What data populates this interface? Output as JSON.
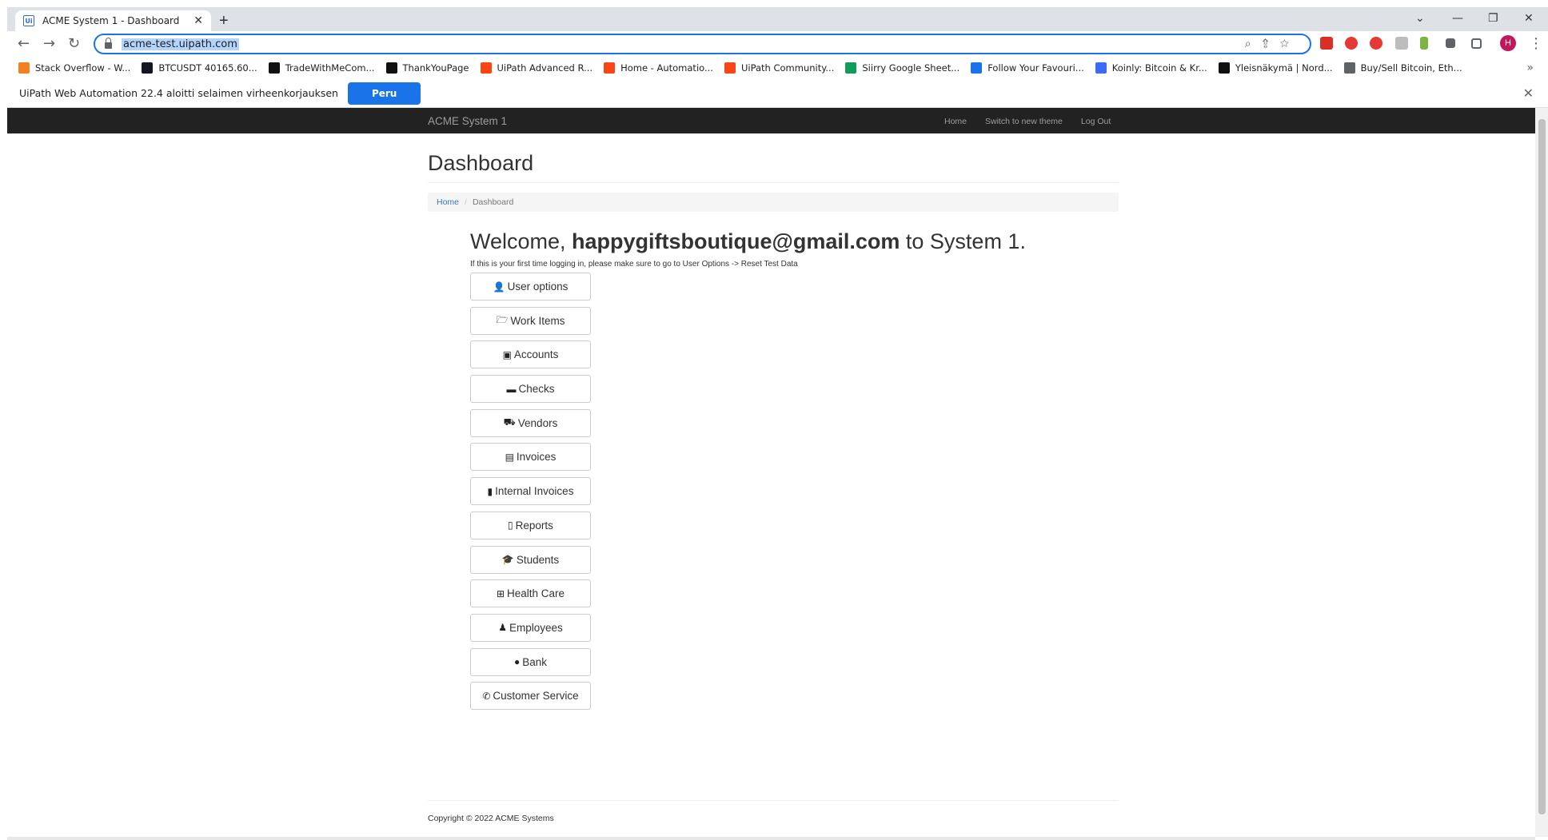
{
  "browser": {
    "tab_title": "ACME System 1 - Dashboard",
    "tab_favicon": "Ui",
    "new_tab": "+",
    "url": "acme-test.uipath.com",
    "profile_initial": "H",
    "bookmarks": [
      {
        "label": "Stack Overflow - W...",
        "color": "#f48024"
      },
      {
        "label": "BTCUSDT 40165.60...",
        "color": "#131722"
      },
      {
        "label": "TradeWithMeCom...",
        "color": "#111111"
      },
      {
        "label": "ThankYouPage",
        "color": "#111111"
      },
      {
        "label": "UiPath Advanced R...",
        "color": "#fa4616"
      },
      {
        "label": "Home - Automatio...",
        "color": "#fa4616"
      },
      {
        "label": "UiPath Community...",
        "color": "#fa4616"
      },
      {
        "label": "Siirry Google Sheet...",
        "color": "#0f9d58"
      },
      {
        "label": "Follow Your Favouri...",
        "color": "#1a73e8"
      },
      {
        "label": "Koinly: Bitcoin & Kr...",
        "color": "#3b6cf6"
      },
      {
        "label": "Yleisnäkymä | Nord...",
        "color": "#111111"
      },
      {
        "label": "Buy/Sell Bitcoin, Eth...",
        "color": "#5f6368"
      }
    ],
    "infobar_text": "UiPath Web Automation 22.4 aloitti selaimen virheenkorjauksen",
    "infobar_button": "Peru"
  },
  "navbar": {
    "brand": "ACME System 1",
    "links": [
      "Home",
      "Switch to new theme",
      "Log Out"
    ]
  },
  "page": {
    "title": "Dashboard",
    "breadcrumb": {
      "home": "Home",
      "current": "Dashboard"
    },
    "welcome_prefix": "Welcome, ",
    "welcome_user": "happygiftsboutique@gmail.com",
    "welcome_suffix": " to System 1.",
    "hint": "If this is your first time logging in, please make sure to go to User Options -> Reset Test Data",
    "buttons": [
      {
        "label": "User options",
        "icon": "user-icon"
      },
      {
        "label": "Work Items",
        "icon": "folder-open-icon"
      },
      {
        "label": "Accounts",
        "icon": "money-icon"
      },
      {
        "label": "Checks",
        "icon": "credit-card-icon"
      },
      {
        "label": "Vendors",
        "icon": "truck-icon"
      },
      {
        "label": "Invoices",
        "icon": "file-text-icon"
      },
      {
        "label": "Internal Invoices",
        "icon": "file-icon"
      },
      {
        "label": "Reports",
        "icon": "file-outline-icon"
      },
      {
        "label": "Students",
        "icon": "graduation-cap-icon"
      },
      {
        "label": "Health Care",
        "icon": "medkit-icon"
      },
      {
        "label": "Employees",
        "icon": "user-tie-icon"
      },
      {
        "label": "Bank",
        "icon": "piggy-bank-icon"
      },
      {
        "label": "Customer Service",
        "icon": "phone-icon"
      }
    ],
    "footer": "Copyright © 2022 ACME Systems"
  }
}
